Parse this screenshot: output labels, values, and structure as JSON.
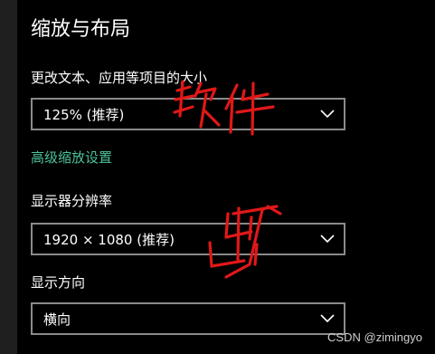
{
  "page": {
    "title": "缩放与布局"
  },
  "scale": {
    "label": "更改文本、应用等项目的大小",
    "value": "125% (推荐)"
  },
  "advanced_link": "高级缩放设置",
  "resolution": {
    "label": "显示器分辨率",
    "value": "1920 × 1080 (推荐)"
  },
  "orientation": {
    "label": "显示方向",
    "value": "横向"
  },
  "annotations": {
    "handwritten_1": "软件",
    "handwritten_2": "出厂",
    "color": "#e01818"
  },
  "watermark": "CSDN @zimingyo",
  "colors": {
    "background": "#000000",
    "link": "#4cc29a",
    "dropdown_border": "#8a8a8a"
  },
  "icons": {
    "dropdown": "chevron-down-icon"
  }
}
